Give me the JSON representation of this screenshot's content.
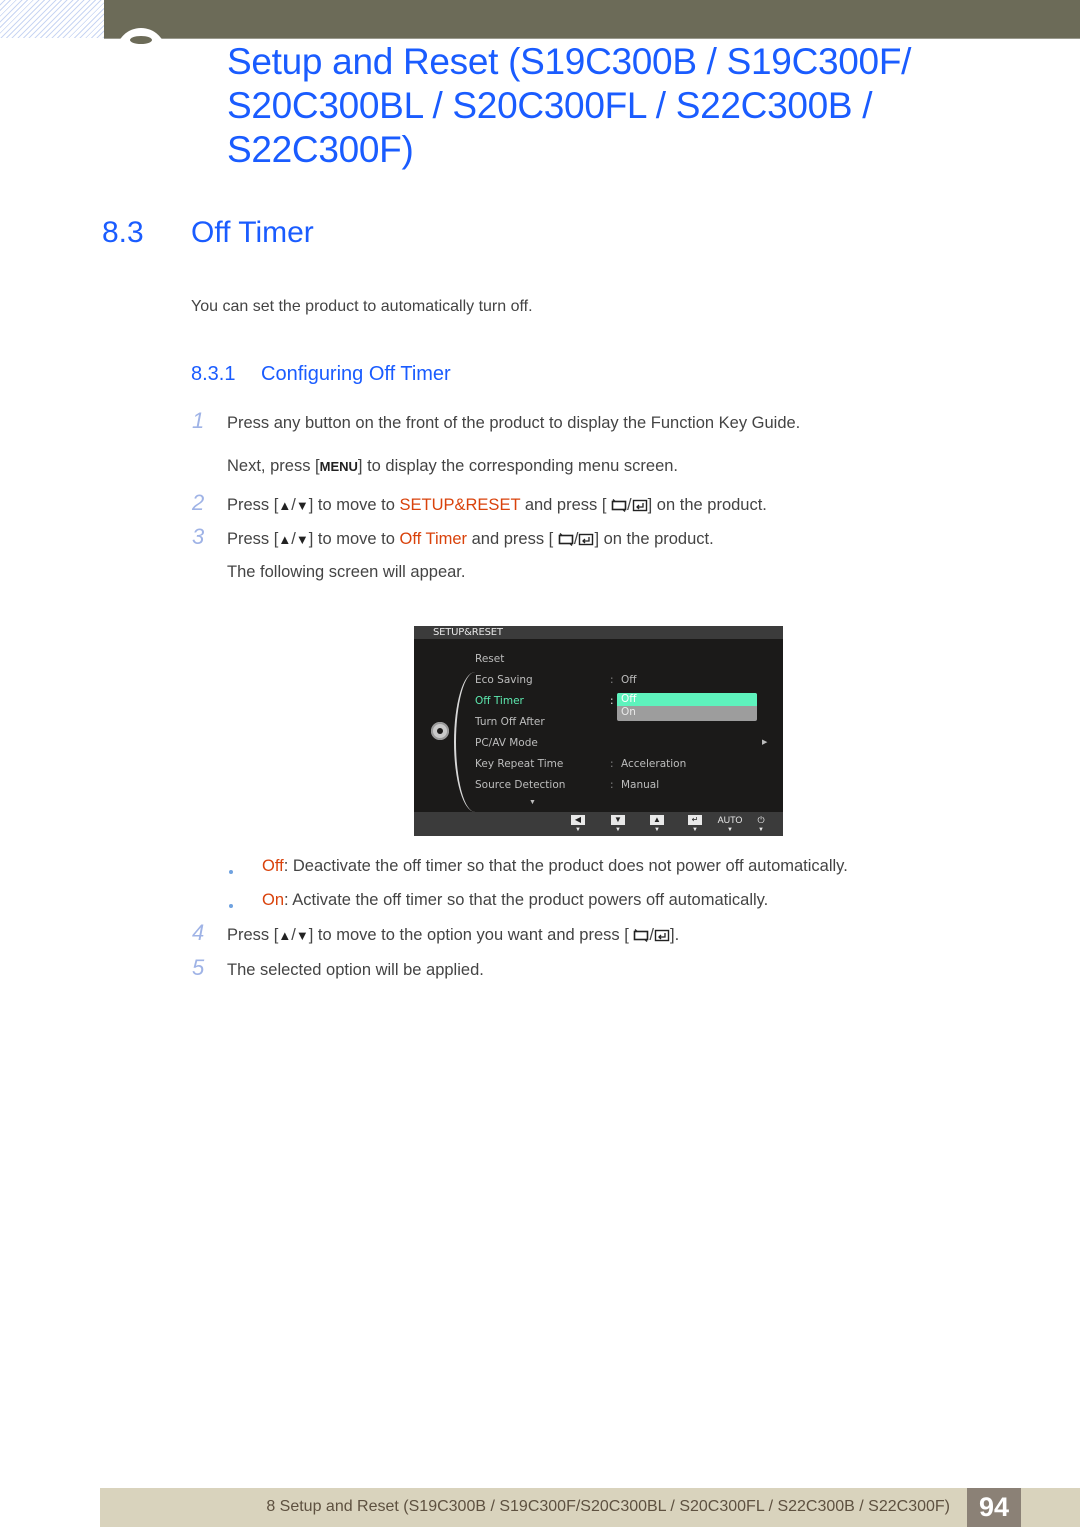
{
  "header": {
    "chapter_title": "Setup and Reset (S19C300B / S19C300F/ S20C300BL / S20C300FL / S22C300B / S22C300F)"
  },
  "section": {
    "number": "8.3",
    "title": "Off Timer",
    "intro": "You can set the product to automatically turn off."
  },
  "subsection": {
    "number": "8.3.1",
    "title": "Configuring Off Timer"
  },
  "steps": [
    {
      "num": "1",
      "text": "Press any button on the front of the product to display the Function Key Guide."
    },
    {
      "num": "",
      "pre": "Next, press [",
      "key": "MENU",
      "post": "] to display the corresponding menu screen."
    },
    {
      "num": "2",
      "pre": "Press [",
      "mid": "] to move to ",
      "highlight": "SETUP&RESET",
      "post1": " and press [",
      "post2": "] on the product."
    },
    {
      "num": "3",
      "pre": "Press [",
      "mid": "] to move to ",
      "highlight": "Off Timer",
      "post1": " and press [",
      "post2": "] on the product."
    },
    {
      "num": "",
      "text": "The following screen will appear."
    },
    {
      "num": "4",
      "pre": "Press [",
      "mid": "] to move to the option you want and press [",
      "post": "]."
    },
    {
      "num": "5",
      "text": "The selected option will be applied."
    }
  ],
  "bullets": [
    {
      "term": "Off",
      "text": ": Deactivate the off timer so that the product does not power off automatically."
    },
    {
      "term": "On",
      "text": ": Activate the off timer so that the product powers off automatically."
    }
  ],
  "osd": {
    "title": "SETUP&RESET",
    "items": [
      {
        "label": "Reset",
        "value": ""
      },
      {
        "label": "Eco Saving",
        "value": "Off"
      },
      {
        "label": "Off Timer",
        "value": ""
      },
      {
        "label": "Turn Off After",
        "value": ""
      },
      {
        "label": "PC/AV Mode",
        "value": ""
      },
      {
        "label": "Key Repeat Time",
        "value": "Acceleration"
      },
      {
        "label": "Source Detection",
        "value": "Manual"
      }
    ],
    "dropdown_options": [
      "Off",
      "On"
    ],
    "selected_option": "Off",
    "function_keys": [
      "left-arrow",
      "down-arrow",
      "up-arrow",
      "enter",
      "AUTO",
      "power"
    ],
    "auto_label": "AUTO",
    "active_color": "#5eeab0"
  },
  "icons": {
    "up": "▲",
    "down": "▼",
    "slash": "/"
  },
  "footer": {
    "text": "8 Setup and Reset (S19C300B / S19C300F/S20C300BL / S20C300FL / S22C300B / S22C300F)",
    "page": "94"
  },
  "colors": {
    "heading_blue": "#1a5cff",
    "highlight_orange": "#d9420b",
    "topbar": "#6c6b58",
    "footer_bg": "#d9d3bd",
    "page_badge": "#8b8176"
  }
}
